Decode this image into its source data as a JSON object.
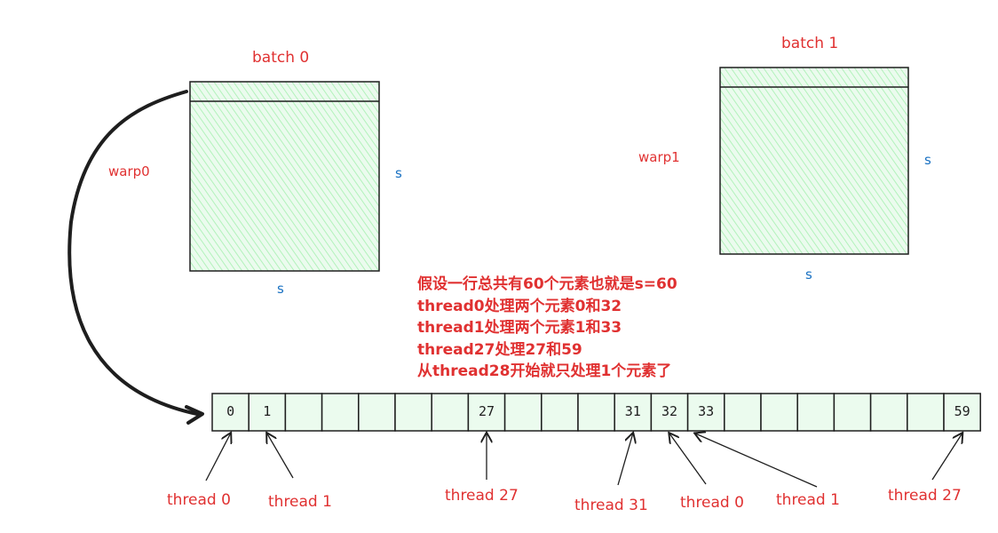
{
  "batches": [
    {
      "label": "batch 0",
      "warp_label": "warp0",
      "s_right": "s",
      "s_bottom": "s"
    },
    {
      "label": "batch 1",
      "warp_label": "warp1",
      "s_right": "s",
      "s_bottom": "s"
    }
  ],
  "note_lines": [
    "假设一行总共有60个元素也就是s=60",
    "thread0处理两个元素0和32",
    "thread1处理两个元素1和33",
    "thread27处理27和59",
    "从thread28开始就只处理1个元素了"
  ],
  "array_cells": [
    "0",
    "1",
    "",
    "",
    "",
    "",
    "",
    "27",
    "",
    "",
    "",
    "31",
    "32",
    "33",
    "",
    "",
    "",
    "",
    "",
    "",
    "59"
  ],
  "thread_labels": [
    {
      "text": "thread 0",
      "cell": "0"
    },
    {
      "text": "thread 1",
      "cell": "1"
    },
    {
      "text": "thread 27",
      "cell": "27"
    },
    {
      "text": "thread 31",
      "cell": "31"
    },
    {
      "text": "thread 0",
      "cell": "32"
    },
    {
      "text": "thread 1",
      "cell": "33"
    },
    {
      "text": "thread 27",
      "cell": "59"
    }
  ],
  "colors": {
    "label_red": "#e03131",
    "s_blue": "#1971c2",
    "fill_green": "#b2f2bb",
    "stroke": "#1e1e1e"
  }
}
